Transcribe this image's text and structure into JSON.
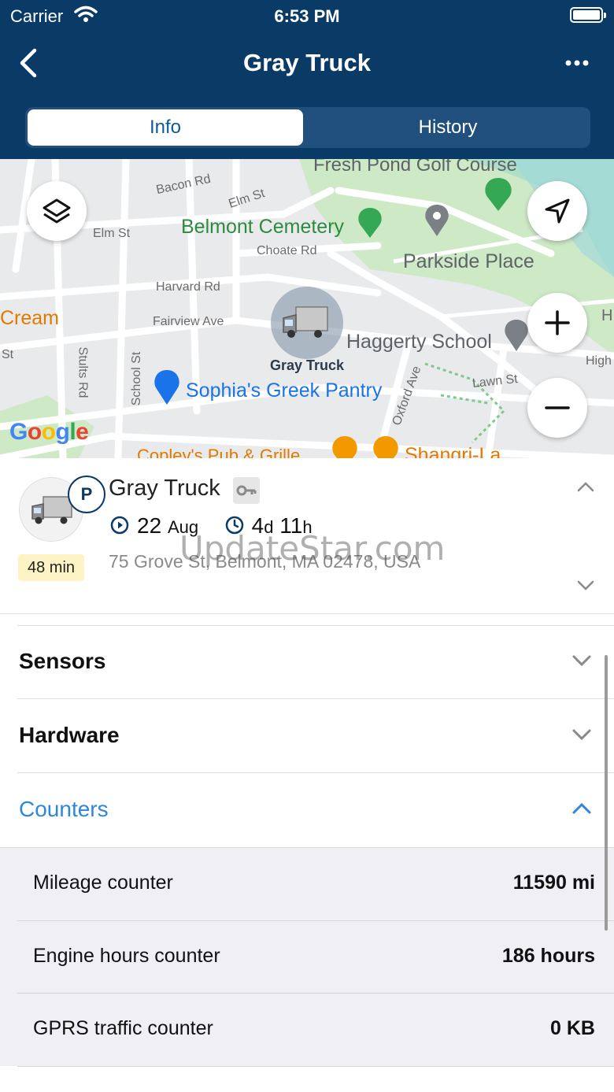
{
  "status_bar": {
    "carrier": "Carrier",
    "time": "6:53 PM"
  },
  "nav": {
    "title": "Gray Truck"
  },
  "tabs": [
    {
      "label": "Info",
      "active": true
    },
    {
      "label": "History",
      "active": false
    }
  ],
  "map": {
    "labels": {
      "fresh_pond": "Fresh Pond Golf Course",
      "bacon_rd": "Bacon Rd",
      "elm_st_top": "Elm St",
      "elm_st_left": "Elm St",
      "belmont_cemetery": "Belmont Cemetery",
      "choate_rd": "Choate Rd",
      "parkside_place": "Parkside Place",
      "harvard_rd": "Harvard Rd",
      "fairview_ave": "Fairview Ave",
      "cream": "Cream",
      "school_st": "School St",
      "stults_rd": "Stults Rd",
      "haggerty_school": "Haggerty School",
      "sophias": "Sophia's Greek Pantry",
      "lawn_st": "Lawn St",
      "oxford_ave": "Oxford Ave",
      "high": "High",
      "copleys": "Copley's Pub & Grille",
      "shangri_la": "Shangri-La",
      "st": "St",
      "h": "H"
    },
    "truck_label": "Gray Truck",
    "google_logo": "Google"
  },
  "unit": {
    "name": "Gray Truck",
    "parking_badge": "P",
    "duration_badge": "48 min",
    "date_day": "22",
    "date_month": "Aug",
    "elapsed_days": "4",
    "elapsed_days_unit": "d",
    "elapsed_hours": "11",
    "elapsed_hours_unit": "h",
    "address": "75 Grove St, Belmont, MA 02478, USA",
    "watermark": "UpdateStar.com"
  },
  "sections": [
    {
      "title": "Sensors",
      "expanded": false
    },
    {
      "title": "Hardware",
      "expanded": false
    },
    {
      "title": "Counters",
      "expanded": true
    }
  ],
  "counters": [
    {
      "label": "Mileage counter",
      "value": "11590 mi"
    },
    {
      "label": "Engine hours counter",
      "value": "186 hours"
    },
    {
      "label": "GPRS traffic counter",
      "value": "0 KB"
    }
  ],
  "colors": {
    "header_bg": "#0a3a66",
    "accent": "#2f86dd",
    "badge_bg": "#fdf3c4"
  }
}
